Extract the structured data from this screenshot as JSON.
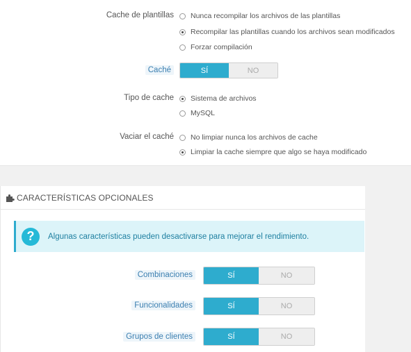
{
  "cache_settings": {
    "template_cache": {
      "label": "Cache de plantillas",
      "options": [
        "Nunca recompilar los archivos de las plantillas",
        "Recompilar las plantillas cuando los archivos sean modificados",
        "Forzar compilación"
      ],
      "selected_index": 1
    },
    "cache": {
      "label": "Caché",
      "yes": "SÍ",
      "no": "NO",
      "value": "SÍ"
    },
    "cache_type": {
      "label": "Tipo de cache",
      "options": [
        "Sistema de archivos",
        "MySQL"
      ],
      "selected_index": 0
    },
    "clear_cache": {
      "label": "Vaciar el caché",
      "options": [
        "No limpiar nunca los archivos de cache",
        "Limpiar la cache siempre que algo se haya modificado"
      ],
      "selected_index": 1
    }
  },
  "optional_features": {
    "title": "CARACTERÍSTICAS OPCIONALES",
    "icon": "puzzle-icon",
    "alert": {
      "icon": "question-icon",
      "text": "Algunas características pueden desactivarse para mejorar el rendimiento."
    },
    "toggles": [
      {
        "label": "Combinaciones",
        "yes": "SÍ",
        "no": "NO",
        "value": "SÍ"
      },
      {
        "label": "Funcionalidades",
        "yes": "SÍ",
        "no": "NO",
        "value": "SÍ"
      },
      {
        "label": "Grupos de clientes",
        "yes": "SÍ",
        "no": "NO",
        "value": "SÍ"
      }
    ]
  },
  "colors": {
    "switch_on": "#2eacce",
    "switch_off": "#eeeeee",
    "alert_bg": "#dcf4f9",
    "alert_text": "#1e7fa0"
  }
}
